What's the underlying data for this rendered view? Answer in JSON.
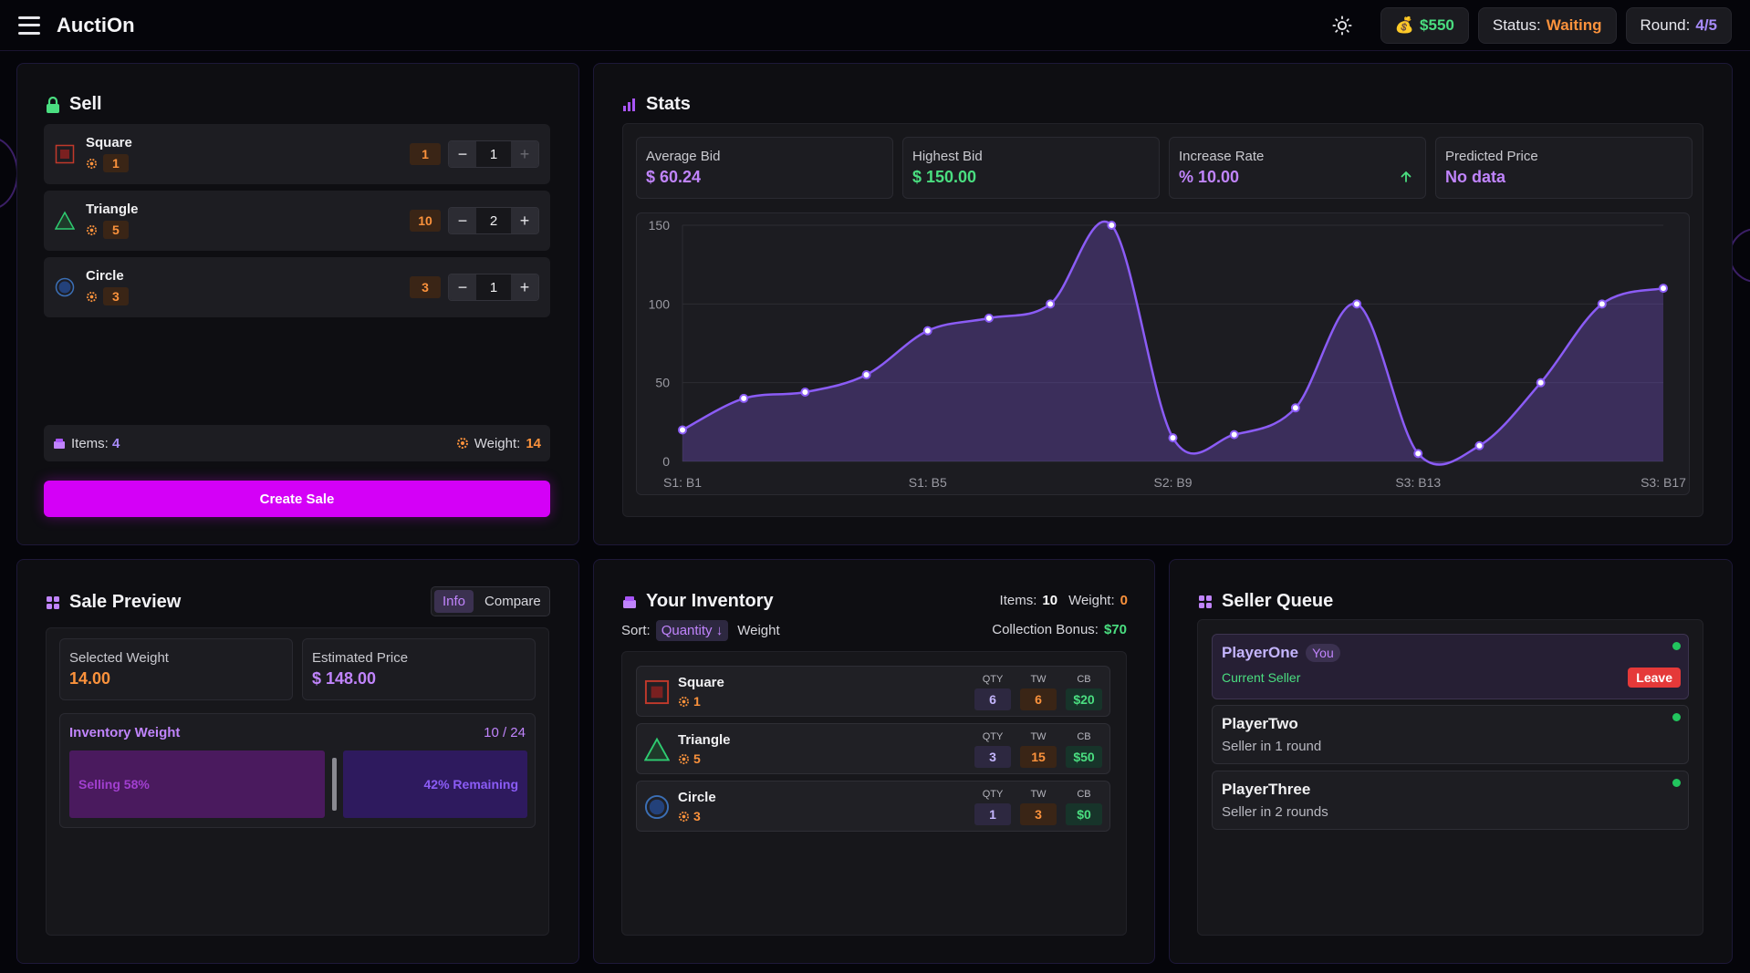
{
  "header": {
    "title": "AuctiOn",
    "money": "$550",
    "status_label": "Status:",
    "status_value": "Waiting",
    "round_label": "Round:",
    "round_value": "4/5"
  },
  "sell": {
    "title": "Sell",
    "items": [
      {
        "name": "Square",
        "weight": "1",
        "available": "1",
        "quantity": "1",
        "shape": "square"
      },
      {
        "name": "Triangle",
        "weight": "5",
        "available": "10",
        "quantity": "2",
        "shape": "triangle"
      },
      {
        "name": "Circle",
        "weight": "3",
        "available": "3",
        "quantity": "1",
        "shape": "circle"
      }
    ],
    "items_label": "Items:",
    "items_count": "4",
    "weight_label": "Weight:",
    "weight_total": "14",
    "create_button": "Create Sale"
  },
  "stats": {
    "title": "Stats",
    "cards": [
      {
        "label": "Average Bid",
        "value": "$ 60.24",
        "color": "#c084fc"
      },
      {
        "label": "Highest Bid",
        "value": "$ 150.00",
        "color": "#4ade80"
      },
      {
        "label": "Increase Rate",
        "value": "% 10.00",
        "color": "#c084fc"
      },
      {
        "label": "Predicted Price",
        "value": "No data",
        "color": "#c084fc"
      }
    ]
  },
  "chart_data": {
    "type": "area",
    "x": [
      "S1: B1",
      "S1: B2",
      "S1: B3",
      "S1: B4",
      "S1: B5",
      "S1: B6",
      "S1: B7",
      "S2: B8",
      "S2: B9",
      "S2: B10",
      "S2: B11",
      "S2: B12",
      "S3: B13",
      "S3: B14",
      "S3: B15",
      "S3: B16",
      "S3: B17"
    ],
    "x_tick_labels": [
      "S1: B1",
      "S1: B5",
      "S2: B9",
      "S3: B13",
      "S3: B17"
    ],
    "values": [
      20,
      40,
      44,
      55,
      83,
      91,
      100,
      150,
      15,
      17,
      34,
      100,
      5,
      10,
      50,
      100,
      110
    ],
    "y_ticks": [
      0,
      50,
      100,
      150
    ],
    "ylim": [
      0,
      150
    ],
    "grid": true,
    "color": "#8b5cf6"
  },
  "preview": {
    "title": "Sale Preview",
    "tab_info": "Info",
    "tab_compare": "Compare",
    "selected_weight_label": "Selected Weight",
    "selected_weight_value": "14.00",
    "estimated_price_label": "Estimated Price",
    "estimated_price_value": "$ 148.00",
    "inventory_weight_label": "Inventory Weight",
    "inventory_weight_value": "10 / 24",
    "selling_label": "Selling 58%",
    "remaining_label": "42% Remaining",
    "selling_fraction": 0.58
  },
  "inventory": {
    "title": "Your Inventory",
    "items_label": "Items:",
    "items_value": "10",
    "weight_label": "Weight:",
    "weight_value": "0",
    "sort_label": "Sort:",
    "sort_quantity": "Quantity ↓",
    "sort_weight": "Weight",
    "bonus_label": "Collection Bonus:",
    "bonus_value": "$70",
    "col_qty": "QTY",
    "col_tw": "TW",
    "col_cb": "CB",
    "rows": [
      {
        "name": "Square",
        "weight": "1",
        "qty": "6",
        "tw": "6",
        "cb": "$20",
        "shape": "square"
      },
      {
        "name": "Triangle",
        "weight": "5",
        "qty": "3",
        "tw": "15",
        "cb": "$50",
        "shape": "triangle"
      },
      {
        "name": "Circle",
        "weight": "3",
        "qty": "1",
        "tw": "3",
        "cb": "$0",
        "shape": "circle"
      }
    ]
  },
  "queue": {
    "title": "Seller Queue",
    "players": [
      {
        "name": "PlayerOne",
        "badge": "You",
        "status": "Current Seller",
        "leave": "Leave"
      },
      {
        "name": "PlayerTwo",
        "status": "Seller in 1 round"
      },
      {
        "name": "PlayerThree",
        "status": "Seller in 2 rounds"
      }
    ]
  }
}
